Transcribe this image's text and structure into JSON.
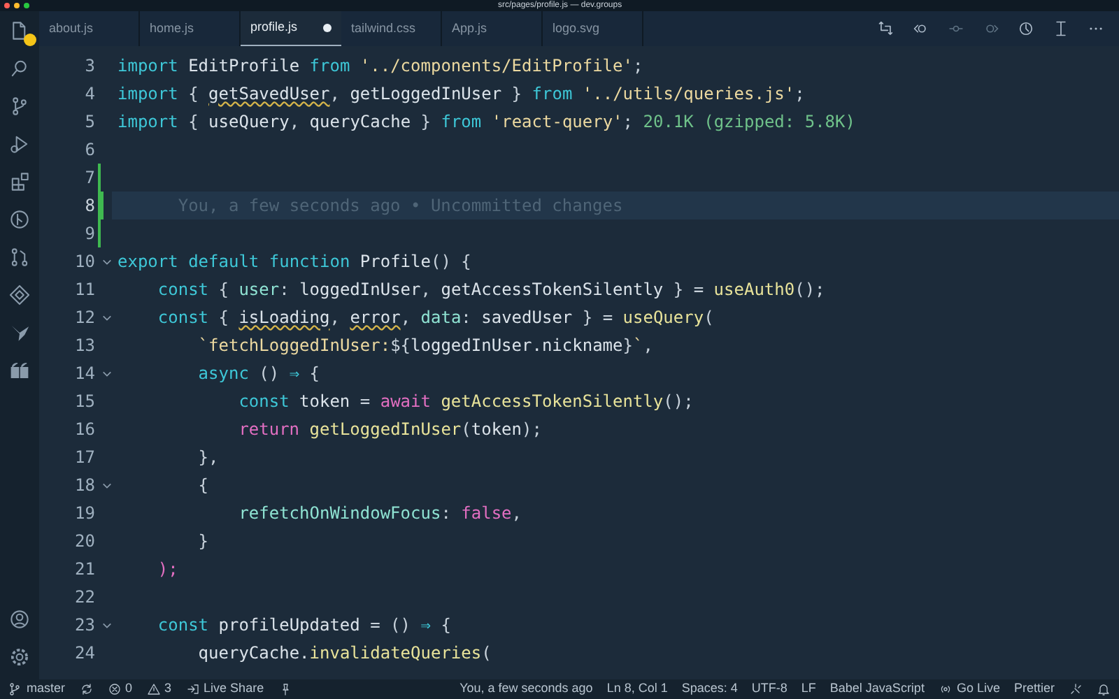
{
  "window": {
    "title": "src/pages/profile.js — dev.groups"
  },
  "activity_bar": {
    "explorer_badge": true
  },
  "tabs": [
    {
      "label": "about.js",
      "selected": false,
      "modified": false
    },
    {
      "label": "home.js",
      "selected": false,
      "modified": false
    },
    {
      "label": "profile.js",
      "selected": true,
      "modified": true
    },
    {
      "label": "tailwind.css",
      "selected": false,
      "modified": false
    },
    {
      "label": "App.js",
      "selected": false,
      "modified": false
    },
    {
      "label": "logo.svg",
      "selected": false,
      "modified": false
    }
  ],
  "lines": [
    {
      "n": "3",
      "fold": false,
      "changed": false,
      "current": false,
      "tokens": [
        {
          "kind": "keyword",
          "t": "import"
        },
        {
          "kind": "identifier",
          "t": " EditProfile "
        },
        {
          "kind": "keyword",
          "t": "from"
        },
        {
          "kind": "string",
          "t": " '../components/EditProfile'"
        },
        {
          "kind": "punctuation",
          "t": ";"
        }
      ]
    },
    {
      "n": "4",
      "fold": false,
      "changed": false,
      "current": false,
      "tokens": [
        {
          "kind": "keyword",
          "t": "import"
        },
        {
          "kind": "punctuation",
          "t": " { "
        },
        {
          "kind": "unused",
          "t": "getSavedUser"
        },
        {
          "kind": "punctuation",
          "t": ", "
        },
        {
          "kind": "identifier",
          "t": "getLoggedInUser"
        },
        {
          "kind": "punctuation",
          "t": " } "
        },
        {
          "kind": "keyword",
          "t": "from"
        },
        {
          "kind": "string",
          "t": " '../utils/queries.js'"
        },
        {
          "kind": "punctuation",
          "t": ";"
        }
      ]
    },
    {
      "n": "5",
      "fold": false,
      "changed": false,
      "current": false,
      "tokens": [
        {
          "kind": "keyword",
          "t": "import"
        },
        {
          "kind": "punctuation",
          "t": " { "
        },
        {
          "kind": "identifier",
          "t": "useQuery"
        },
        {
          "kind": "punctuation",
          "t": ", "
        },
        {
          "kind": "identifier",
          "t": "queryCache"
        },
        {
          "kind": "punctuation",
          "t": " } "
        },
        {
          "kind": "keyword",
          "t": "from"
        },
        {
          "kind": "string",
          "t": " 'react-query'"
        },
        {
          "kind": "punctuation",
          "t": "; "
        },
        {
          "kind": "hint",
          "t": "20.1K (gzipped: 5.8K)"
        }
      ]
    },
    {
      "n": "6",
      "fold": false,
      "changed": false,
      "current": false
    },
    {
      "n": "7",
      "fold": false,
      "changed": true,
      "current": false
    },
    {
      "n": "8",
      "fold": false,
      "changed": true,
      "current": true,
      "tokens": [
        {
          "kind": "blame",
          "t": "      You, a few seconds ago • Uncommitted changes"
        }
      ]
    },
    {
      "n": "9",
      "fold": false,
      "changed": true,
      "current": false
    },
    {
      "n": "10",
      "fold": true,
      "changed": false,
      "current": false,
      "tokens": [
        {
          "kind": "keyword",
          "t": "export default function"
        },
        {
          "kind": "identifier",
          "t": " Profile"
        },
        {
          "kind": "punctuation",
          "t": "() {"
        }
      ]
    },
    {
      "n": "11",
      "fold": false,
      "changed": false,
      "current": false,
      "tokens": [
        {
          "kind": "keyword",
          "t": "    const"
        },
        {
          "kind": "punctuation",
          "t": " { "
        },
        {
          "kind": "property",
          "t": "user"
        },
        {
          "kind": "punctuation",
          "t": ": "
        },
        {
          "kind": "identifier",
          "t": "loggedInUser"
        },
        {
          "kind": "punctuation",
          "t": ", "
        },
        {
          "kind": "identifier",
          "t": "getAccessTokenSilently"
        },
        {
          "kind": "punctuation",
          "t": " } = "
        },
        {
          "kind": "function",
          "t": "useAuth0"
        },
        {
          "kind": "punctuation",
          "t": "();"
        }
      ]
    },
    {
      "n": "12",
      "fold": true,
      "changed": false,
      "current": false,
      "tokens": [
        {
          "kind": "keyword",
          "t": "    const"
        },
        {
          "kind": "punctuation",
          "t": " { "
        },
        {
          "kind": "unused",
          "t": "isLoading"
        },
        {
          "kind": "punctuation",
          "t": ", "
        },
        {
          "kind": "unused",
          "t": "error"
        },
        {
          "kind": "punctuation",
          "t": ", "
        },
        {
          "kind": "property",
          "t": "data"
        },
        {
          "kind": "punctuation",
          "t": ": "
        },
        {
          "kind": "identifier",
          "t": "savedUser"
        },
        {
          "kind": "punctuation",
          "t": " } = "
        },
        {
          "kind": "function",
          "t": "useQuery"
        },
        {
          "kind": "punctuation",
          "t": "("
        }
      ]
    },
    {
      "n": "13",
      "fold": false,
      "changed": false,
      "current": false,
      "tokens": [
        {
          "kind": "string",
          "t": "        `fetchLoggedInUser:"
        },
        {
          "kind": "punctuation",
          "t": "${"
        },
        {
          "kind": "identifier",
          "t": "loggedInUser.nickname"
        },
        {
          "kind": "punctuation",
          "t": "}"
        },
        {
          "kind": "string",
          "t": "`"
        },
        {
          "kind": "punctuation",
          "t": ","
        }
      ]
    },
    {
      "n": "14",
      "fold": true,
      "changed": false,
      "current": false,
      "tokens": [
        {
          "kind": "keyword",
          "t": "        async"
        },
        {
          "kind": "punctuation",
          "t": " () "
        },
        {
          "kind": "keyword",
          "t": "⇒"
        },
        {
          "kind": "punctuation",
          "t": " {"
        }
      ]
    },
    {
      "n": "15",
      "fold": false,
      "changed": false,
      "current": false,
      "tokens": [
        {
          "kind": "keyword",
          "t": "            const"
        },
        {
          "kind": "identifier",
          "t": " token "
        },
        {
          "kind": "punctuation",
          "t": "= "
        },
        {
          "kind": "control",
          "t": "await"
        },
        {
          "kind": "function",
          "t": " getAccessTokenSilently"
        },
        {
          "kind": "punctuation",
          "t": "();"
        }
      ]
    },
    {
      "n": "16",
      "fold": false,
      "changed": false,
      "current": false,
      "tokens": [
        {
          "kind": "control",
          "t": "            return"
        },
        {
          "kind": "function",
          "t": " getLoggedInUser"
        },
        {
          "kind": "punctuation",
          "t": "("
        },
        {
          "kind": "identifier",
          "t": "token"
        },
        {
          "kind": "punctuation",
          "t": ");"
        }
      ]
    },
    {
      "n": "17",
      "fold": false,
      "changed": false,
      "current": false,
      "tokens": [
        {
          "kind": "punctuation",
          "t": "        },"
        }
      ]
    },
    {
      "n": "18",
      "fold": true,
      "changed": false,
      "current": false,
      "tokens": [
        {
          "kind": "punctuation",
          "t": "        {"
        }
      ]
    },
    {
      "n": "19",
      "fold": false,
      "changed": false,
      "current": false,
      "tokens": [
        {
          "kind": "property",
          "t": "            refetchOnWindowFocus"
        },
        {
          "kind": "punctuation",
          "t": ": "
        },
        {
          "kind": "control",
          "t": "false"
        },
        {
          "kind": "punctuation",
          "t": ","
        }
      ]
    },
    {
      "n": "20",
      "fold": false,
      "changed": false,
      "current": false,
      "tokens": [
        {
          "kind": "punctuation",
          "t": "        }"
        }
      ]
    },
    {
      "n": "21",
      "fold": false,
      "changed": false,
      "current": false,
      "tokens": [
        {
          "kind": "control",
          "t": "    );"
        }
      ]
    },
    {
      "n": "22",
      "fold": false,
      "changed": false,
      "current": false
    },
    {
      "n": "23",
      "fold": true,
      "changed": false,
      "current": false,
      "tokens": [
        {
          "kind": "keyword",
          "t": "    const"
        },
        {
          "kind": "identifier",
          "t": " profileUpdated "
        },
        {
          "kind": "punctuation",
          "t": "= () "
        },
        {
          "kind": "keyword",
          "t": "⇒"
        },
        {
          "kind": "punctuation",
          "t": " {"
        }
      ]
    },
    {
      "n": "24",
      "fold": false,
      "changed": false,
      "current": false,
      "tokens": [
        {
          "kind": "identifier",
          "t": "        queryCache."
        },
        {
          "kind": "function",
          "t": "invalidateQueries"
        },
        {
          "kind": "punctuation",
          "t": "("
        }
      ]
    }
  ],
  "status_bar": {
    "left": [
      {
        "kind": "branch",
        "text": "master"
      },
      {
        "kind": "sync"
      },
      {
        "kind": "errors",
        "text": "0"
      },
      {
        "kind": "warnings",
        "text": "3"
      },
      {
        "kind": "live-share",
        "text": "Live Share"
      },
      {
        "kind": "pin"
      }
    ],
    "right": [
      {
        "kind": "text",
        "text": "You, a few seconds ago"
      },
      {
        "kind": "text",
        "text": "Ln 8, Col 1"
      },
      {
        "kind": "text",
        "text": "Spaces: 4"
      },
      {
        "kind": "text",
        "text": "UTF-8"
      },
      {
        "kind": "text",
        "text": "LF"
      },
      {
        "kind": "text",
        "text": "Babel JavaScript"
      },
      {
        "kind": "go-live",
        "text": "Go Live"
      },
      {
        "kind": "text",
        "text": "Prettier"
      },
      {
        "kind": "feedback"
      },
      {
        "kind": "bell"
      }
    ]
  }
}
